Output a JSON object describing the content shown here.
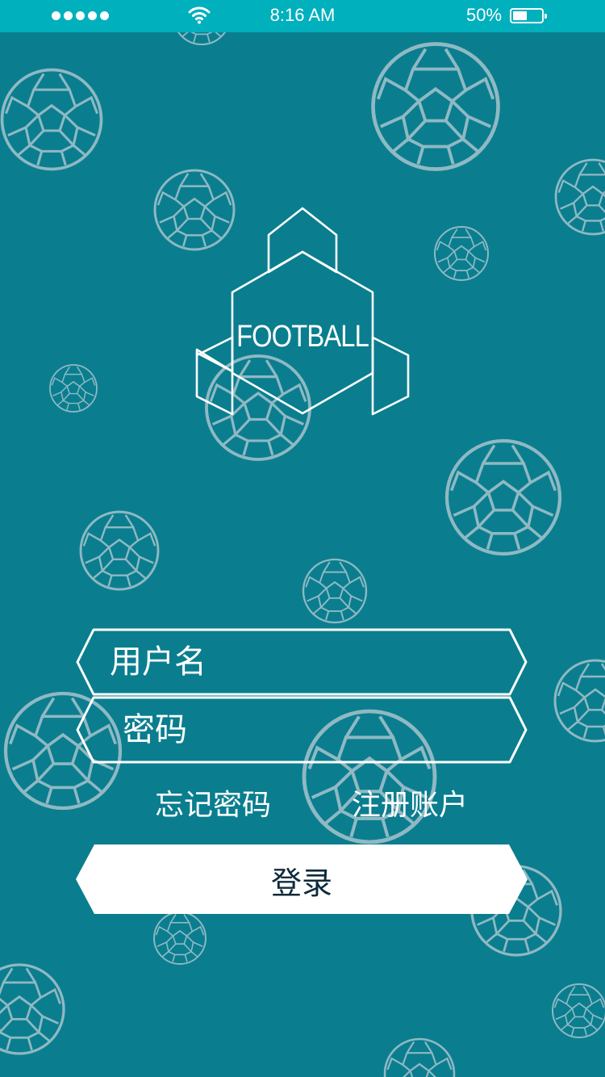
{
  "status_bar": {
    "time": "8:16 AM",
    "battery_percent_label": "50%",
    "battery_level": 0.5,
    "signal_bars": 5,
    "icons": [
      "signal-dots-icon",
      "wifi-icon",
      "battery-icon"
    ]
  },
  "logo": {
    "text": "FOOTBALL"
  },
  "form": {
    "username_placeholder": "用户名",
    "password_placeholder": "密码",
    "forgot_password": "忘记密码",
    "register": "注册账户",
    "login_button": "登录"
  },
  "colors": {
    "background": "#0a7e8f",
    "status_bar": "#00b0bd",
    "ball_outline": "#8fb9c3",
    "white": "#ffffff",
    "button_text": "#0f2a3c"
  }
}
